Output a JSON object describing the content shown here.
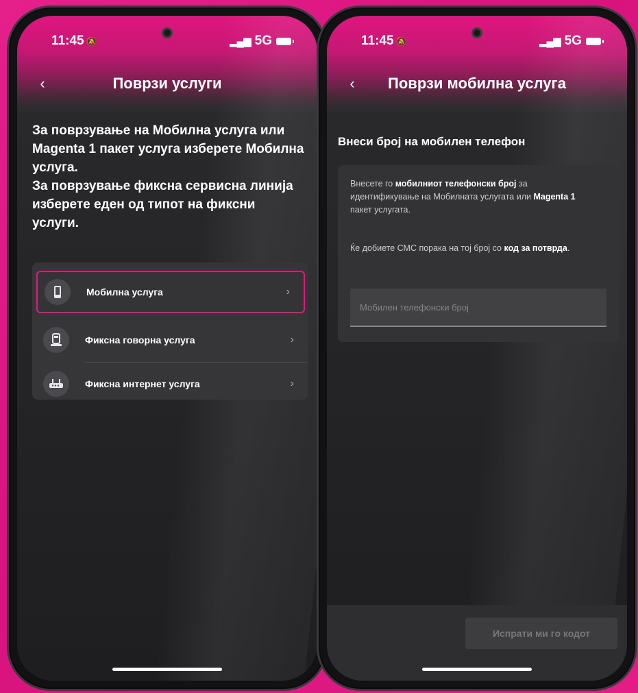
{
  "left_phone": {
    "status": {
      "time": "11:45",
      "network": "5G"
    },
    "nav": {
      "back": "‹",
      "title": "Поврзи услуги"
    },
    "intro": {
      "line1": "За поврзување на Мобилна услуга или Magenta 1 пакет услуга изберете Мобилна услуга.",
      "line2": "За поврзување фиксна сервисна линија изберете еден од типот на фиксни услуги."
    },
    "services": [
      {
        "label": "Мобилна услуга",
        "icon": "mobile-phone-icon",
        "selected": true
      },
      {
        "label": "Фиксна говорна услуга",
        "icon": "landline-phone-icon",
        "selected": false
      },
      {
        "label": "Фиксна интернет услуга",
        "icon": "router-icon",
        "selected": false
      }
    ],
    "chevron": "›"
  },
  "right_phone": {
    "status": {
      "time": "11:45",
      "network": "5G"
    },
    "nav": {
      "back": "‹",
      "title": "Поврзи мобилна услуга"
    },
    "section_title": "Внеси број на мобилен телефон",
    "info": {
      "p1_pre": "Внесете го ",
      "p1_bold1": "мобилниот телефонски број",
      "p1_mid": " за идентификување на Мобилната услугата или ",
      "p1_bold2": "Magenta 1",
      "p1_post": " пакет услугата.",
      "p2_pre": "Ќе добиете СМС порака на тој број со ",
      "p2_bold": "код за потврда",
      "p2_post": "."
    },
    "input": {
      "placeholder": "Мобилен телефонски број",
      "value": ""
    },
    "send_button": "Испрати ми го кодот"
  },
  "colors": {
    "accent": "#e2187f",
    "background": "#e6208a"
  }
}
